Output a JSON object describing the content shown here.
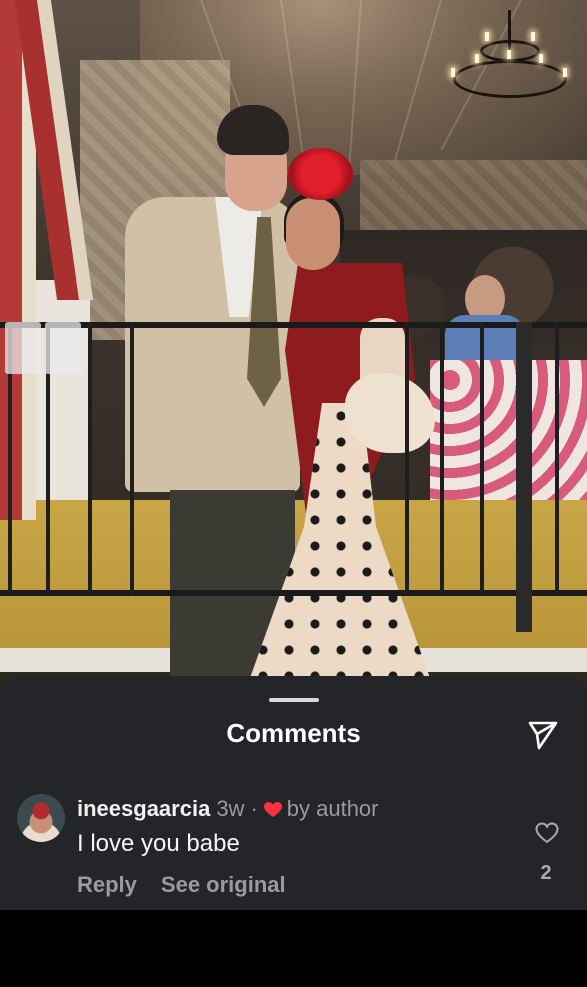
{
  "photo": {
    "description_icon": "photo-background"
  },
  "sheet": {
    "title": "Comments",
    "share_icon": "send-icon"
  },
  "comment": {
    "username": "ineesgaarcia",
    "time": "3w",
    "separator": "·",
    "author_badge": "by author",
    "text": "I love you babe",
    "reply_label": "Reply",
    "see_original_label": "See original",
    "like_count": "2",
    "like_icon": "heart-outline-icon",
    "author_heart_color": "#ff3040"
  },
  "colors": {
    "sheet_bg": "#242528",
    "secondary_text": "#9a9ba0"
  }
}
